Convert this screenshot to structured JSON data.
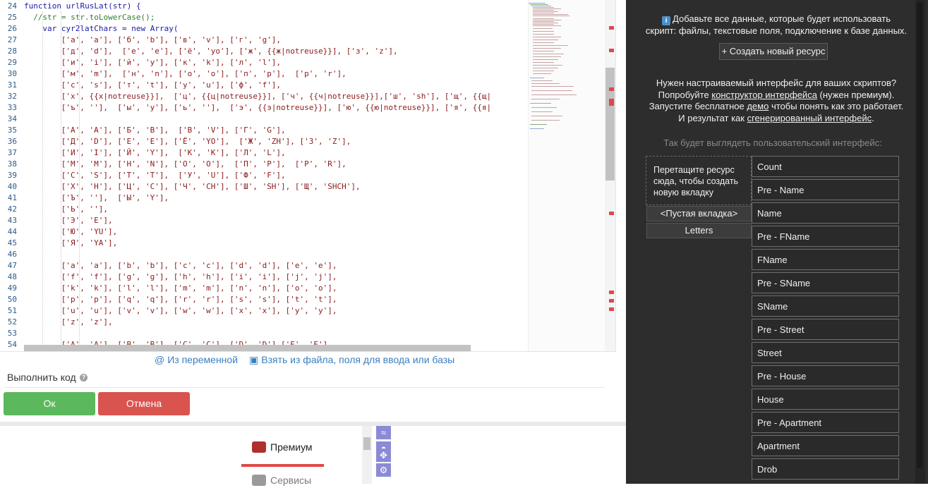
{
  "editor": {
    "lines": [
      {
        "num": "24",
        "text": "function urlRusLat(str) {",
        "cls": "kw",
        "indent": 0
      },
      {
        "num": "25",
        "text": "//str = str.toLowerCase();",
        "cls": "cm",
        "indent": 1
      },
      {
        "num": "26",
        "text": "var cyr2latChars = new Array(",
        "cls": "kw",
        "indent": 2
      },
      {
        "num": "27",
        "text": "['а', 'a'], ['б', 'b'], ['в', 'v'], ['г', 'g'],",
        "cls": "",
        "indent": 4
      },
      {
        "num": "28",
        "text": "['д', 'd'],  ['е', 'e'], ['ё', 'yo'], ['ж', {{ж|notreuse}}], ['з', 'z'],",
        "cls": "",
        "indent": 4
      },
      {
        "num": "29",
        "text": "['и', 'i'], ['й', 'y'], ['к', 'k'], ['л', 'l'],",
        "cls": "",
        "indent": 4
      },
      {
        "num": "30",
        "text": "['м', 'm'],  ['н', 'n'], ['о', 'o'], ['п', 'p'],  ['р', 'r'],",
        "cls": "",
        "indent": 4
      },
      {
        "num": "31",
        "text": "['с', 's'], ['т', 't'], ['у', 'u'], ['ф', 'f'],",
        "cls": "",
        "indent": 4
      },
      {
        "num": "32",
        "text": "['х', {{х|notreuse}}],  ['ц', {{ц|notreuse}}], ['ч', {{ч|notreuse}}],['ш', 'sh'], ['щ', {{щ|",
        "cls": "",
        "indent": 4
      },
      {
        "num": "33",
        "text": "['ъ', ''],  ['ы', 'y'], ['ь', ''],  ['э', {{э|notreuse}}], ['ю', {{ю|notreuse}}], ['я', {{я|",
        "cls": "",
        "indent": 4
      },
      {
        "num": "34",
        "text": "",
        "cls": "",
        "indent": 0
      },
      {
        "num": "35",
        "text": "['А', 'A'], ['Б', 'B'],  ['В', 'V'], ['Г', 'G'],",
        "cls": "",
        "indent": 4
      },
      {
        "num": "36",
        "text": "['Д', 'D'], ['Е', 'E'], ['Ё', 'YO'],  ['Ж', 'ZH'], ['З', 'Z'],",
        "cls": "",
        "indent": 4
      },
      {
        "num": "37",
        "text": "['И', 'I'], ['Й', 'Y'],  ['К', 'K'], ['Л', 'L'],",
        "cls": "",
        "indent": 4
      },
      {
        "num": "38",
        "text": "['М', 'M'], ['Н', 'N'], ['О', 'O'],  ['П', 'P'],  ['Р', 'R'],",
        "cls": "",
        "indent": 4
      },
      {
        "num": "39",
        "text": "['С', 'S'], ['Т', 'T'],  ['У', 'U'], ['Ф', 'F'],",
        "cls": "",
        "indent": 4
      },
      {
        "num": "40",
        "text": "['Х', 'H'], ['Ц', 'C'], ['Ч', 'CH'], ['Ш', 'SH'], ['Щ', 'SHCH'],",
        "cls": "",
        "indent": 4
      },
      {
        "num": "41",
        "text": "['Ъ', ''],  ['Ы', 'Y'],",
        "cls": "",
        "indent": 4
      },
      {
        "num": "42",
        "text": "['Ь', ''],",
        "cls": "",
        "indent": 4
      },
      {
        "num": "43",
        "text": "['Э', 'E'],",
        "cls": "",
        "indent": 4
      },
      {
        "num": "44",
        "text": "['Ю', 'YU'],",
        "cls": "",
        "indent": 4
      },
      {
        "num": "45",
        "text": "['Я', 'YA'],",
        "cls": "",
        "indent": 4
      },
      {
        "num": "46",
        "text": "",
        "cls": "",
        "indent": 0
      },
      {
        "num": "47",
        "text": "['a', 'a'], ['b', 'b'], ['c', 'c'], ['d', 'd'], ['e', 'e'],",
        "cls": "",
        "indent": 4
      },
      {
        "num": "48",
        "text": "['f', 'f'], ['g', 'g'], ['h', 'h'], ['i', 'i'], ['j', 'j'],",
        "cls": "",
        "indent": 4
      },
      {
        "num": "49",
        "text": "['k', 'k'], ['l', 'l'], ['m', 'm'], ['n', 'n'], ['o', 'o'],",
        "cls": "",
        "indent": 4
      },
      {
        "num": "50",
        "text": "['p', 'p'], ['q', 'q'], ['r', 'r'], ['s', 's'], ['t', 't'],",
        "cls": "",
        "indent": 4
      },
      {
        "num": "51",
        "text": "['u', 'u'], ['v', 'v'], ['w', 'w'], ['x', 'x'], ['y', 'y'],",
        "cls": "",
        "indent": 4
      },
      {
        "num": "52",
        "text": "['z', 'z'],",
        "cls": "",
        "indent": 4
      },
      {
        "num": "53",
        "text": "",
        "cls": "",
        "indent": 0
      },
      {
        "num": "54",
        "text": "['A', 'A'], ['B', 'B'], ['C', 'C'], ['D', 'D'],['E', 'E'],",
        "cls": "",
        "indent": 4
      }
    ]
  },
  "links": {
    "from_variable": "Из переменной",
    "from_file": "Взять из файла, поля для ввода или базы"
  },
  "run": {
    "label": "Выполнить код",
    "help": "?"
  },
  "buttons": {
    "ok": "Ок",
    "cancel": "Отмена"
  },
  "bottom_menu": {
    "premium": "Премиум",
    "services": "Сервисы"
  },
  "right_panel": {
    "info_line1": "Добавьте все данные, которые будет использовать",
    "info_line2": "скрипт: файлы, текстовые поля, подключение к базе данных.",
    "create_resource": "+ Создать новый ресурс",
    "custom_ui_line1": "Нужен настраиваемый интерфейс для ваших скриптов?",
    "custom_ui_line2_pre": "Попробуйте ",
    "custom_ui_line2_link": "конструктор интерфейса",
    "custom_ui_line2_post": " (нужен премиум).",
    "custom_ui_line3_pre": "Запустите бесплатное ",
    "custom_ui_line3_link": "демо",
    "custom_ui_line3_post": " чтобы понять как это работает.",
    "custom_ui_line4_pre": "И результат как ",
    "custom_ui_line4_link": "сгенерированный интерфейс",
    "custom_ui_line4_post": ".",
    "preview_caption": "Так будет выглядеть пользовательский интерфейс:",
    "drop_zone": "Перетащите ресурс сюда, чтобы создать новую вкладку",
    "tabs": [
      "<Пустая вкладка>",
      "Letters"
    ],
    "resources": [
      "Count",
      "Pre - Name",
      "Name",
      "Pre - FName",
      "FName",
      "Pre - SName",
      "SName",
      "Pre - Street",
      "Street",
      "Pre - House",
      "House",
      "Pre - Apartment",
      "Apartment",
      "Drob"
    ]
  },
  "colors": {
    "ok": "#5cb85c",
    "cancel": "#d9534f",
    "panel_bg": "#2d2d2d",
    "link": "#3a7fc1",
    "premium_accent": "#e04848"
  }
}
